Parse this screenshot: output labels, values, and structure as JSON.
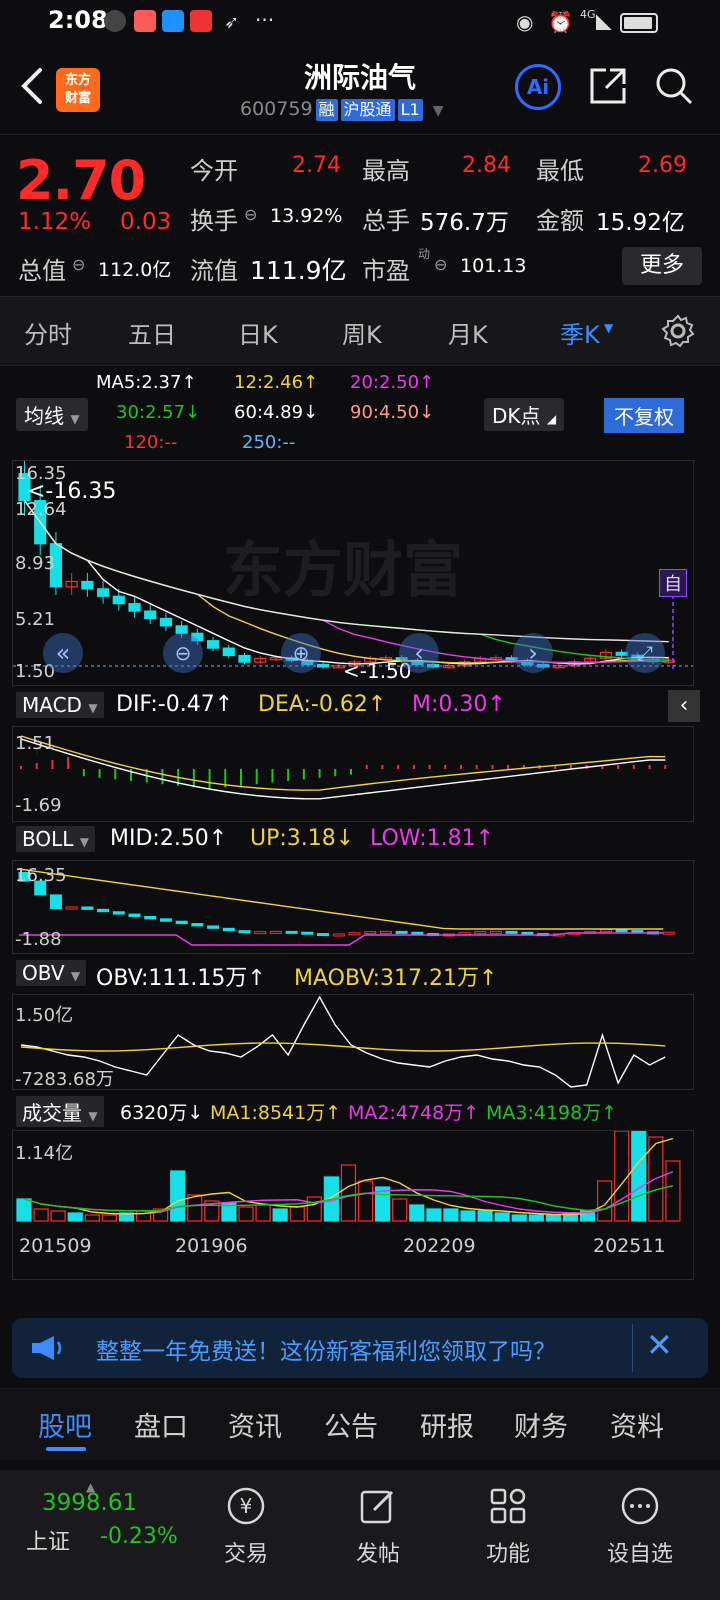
{
  "status_bar": {
    "time": "2:08",
    "network": "4G"
  },
  "header": {
    "title": "洲际油气",
    "code": "600759",
    "tags": [
      "融",
      "沪股通",
      "L1"
    ],
    "logo_text": [
      "东方",
      "财富"
    ],
    "ai_label": "Ai"
  },
  "quote": {
    "price": "2.70",
    "change_pct": "1.12%",
    "change_abs": "0.03",
    "open_label": "今开",
    "open": "2.74",
    "high_label": "最高",
    "high": "2.84",
    "low_label": "最低",
    "low": "2.69",
    "turnover_label": "换手",
    "turnover": "13.92%",
    "volume_label": "总手",
    "volume": "576.7万",
    "amount_label": "金额",
    "amount": "15.92亿",
    "mktcap_label": "总值",
    "mktcap": "112.0亿",
    "float_label": "流值",
    "float_cap": "111.9亿",
    "pe_label": "市盈",
    "pe_sup": "动",
    "pe": "101.13",
    "more_label": "更多"
  },
  "period_tabs": [
    "分时",
    "五日",
    "日K",
    "周K",
    "月K",
    "季K"
  ],
  "active_tab": "季K",
  "ma_legend": {
    "chip": "均线",
    "ma5": "MA5:2.37↑",
    "ma12": "12:2.46↑",
    "ma20": "20:2.50↑",
    "ma30": "30:2.57↓",
    "ma60": "60:4.89↓",
    "ma90": "90:4.50↓",
    "ma120": "120:--",
    "ma250": "250:--",
    "dk": "DK点",
    "fq": "不复权"
  },
  "kline": {
    "max_label": "16.35",
    "arrow_max": "<-16.35",
    "y2": "12.64",
    "y3": "8.93",
    "y4": "5.21",
    "min_label": "1.50",
    "arrow_min": "<-1.50",
    "watermark": "东方财富",
    "zi": "自"
  },
  "macd": {
    "chip": "MACD",
    "dif": "DIF:-0.47↑",
    "dea": "DEA:-0.62↑",
    "m": "M:0.30↑",
    "ymax": "1.51",
    "ymin": "-1.69"
  },
  "boll": {
    "chip": "BOLL",
    "mid": "MID:2.50↑",
    "up": "UP:3.18↓",
    "low": "LOW:1.81↑",
    "ymax": "16.35",
    "ymin": "-1.88"
  },
  "obv": {
    "chip": "OBV",
    "obv": "OBV:111.15万↑",
    "maobv": "MAOBV:317.21万↑",
    "ymax": "1.50亿",
    "ymin": "-7283.68万"
  },
  "vol": {
    "chip": "成交量",
    "v": "6320万↓",
    "ma1": "MA1:8541万↑",
    "ma2": "MA2:4748万↑",
    "ma3": "MA3:4198万↑",
    "ymax": "1.14亿"
  },
  "x_axis": [
    "201509",
    "201906",
    "202209",
    "202511"
  ],
  "banner": {
    "text": "整整一年免费送！这份新客福利您领取了吗？"
  },
  "info_tabs": [
    "股吧",
    "盘口",
    "资讯",
    "公告",
    "研报",
    "财务",
    "资料"
  ],
  "active_info_tab": "股吧",
  "bottom_bar": {
    "index_value": "3998.61",
    "index_name": "上证",
    "index_change": "-0.23%",
    "items": [
      "交易",
      "发帖",
      "功能",
      "设自选"
    ]
  },
  "colors": {
    "red": "#ff2b2b",
    "green": "#1fc41f",
    "cyan": "#15e0e8",
    "yellow": "#f2d23a",
    "magenta": "#e83be8",
    "blue": "#3b8cff"
  }
}
